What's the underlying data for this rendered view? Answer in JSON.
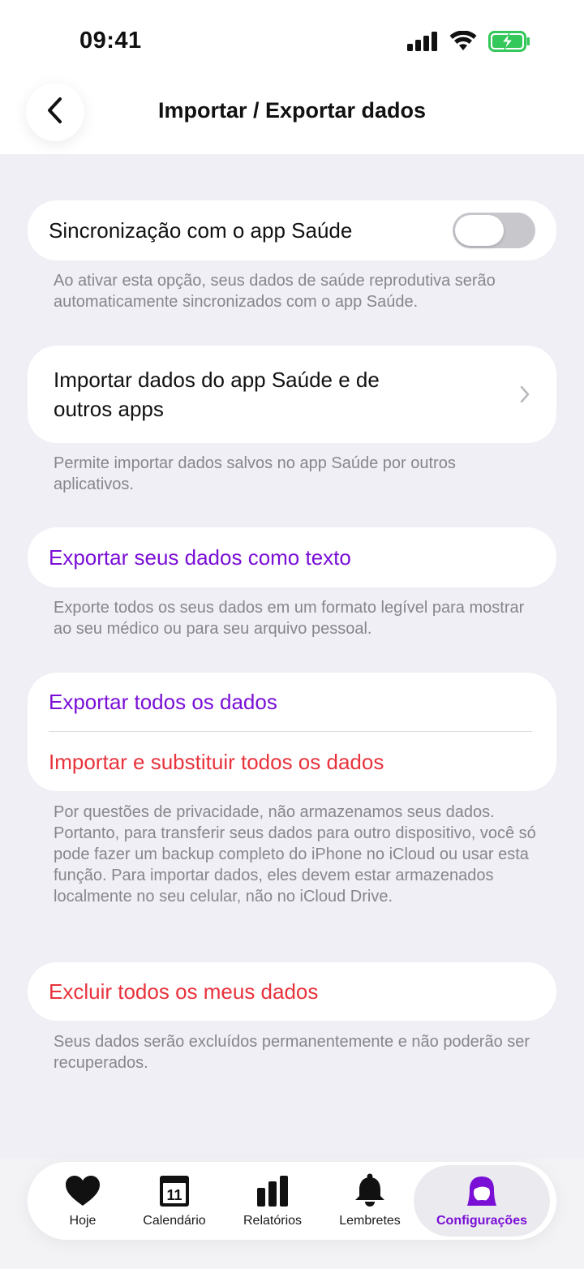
{
  "status_bar": {
    "time": "09:41",
    "icons": [
      "cellular-signal-icon",
      "wifi-icon",
      "battery-charging-icon"
    ]
  },
  "header": {
    "title": "Importar / Exportar dados",
    "back_icon": "chevron-left-icon"
  },
  "sections": {
    "health_sync": {
      "label": "Sincronização com o app Saúde",
      "toggle_on": false,
      "note": "Ao ativar esta opção, seus dados de saúde reprodutiva serão automaticamente sincronizados com o app Saúde."
    },
    "import_health": {
      "label_line1": "Importar dados do app Saúde e de",
      "label_line2": "outros apps",
      "note": "Permite importar dados salvos no app Saúde por outros aplicativos."
    },
    "export_text": {
      "label": "Exportar seus dados como texto",
      "note": "Exporte todos os seus dados em um formato legível para mostrar ao seu médico ou para seu arquivo pessoal."
    },
    "export_import_all": {
      "export_label": "Exportar todos os dados",
      "import_label": "Importar e substituir todos os dados",
      "note": "Por questões de privacidade, não armazenamos seus dados. Portanto, para transferir seus dados para outro dispositivo, você só pode fazer um backup completo do iPhone no iCloud ou usar esta função. Para importar dados, eles devem estar armazenados localmente no seu celular, não no iCloud Drive."
    },
    "delete_all": {
      "label": "Excluir todos os meus dados",
      "note": "Seus dados serão excluídos permanentemente e não poderão ser recuperados."
    }
  },
  "tabbar": {
    "tabs": [
      {
        "label": "Hoje",
        "icon": "heart-icon"
      },
      {
        "label": "Calendário",
        "icon": "calendar-icon",
        "icon_text": "11"
      },
      {
        "label": "Relatórios",
        "icon": "bar-chart-icon"
      },
      {
        "label": "Lembretes",
        "icon": "bell-icon"
      },
      {
        "label": "Configurações",
        "icon": "profile-icon",
        "active": true
      }
    ]
  },
  "colors": {
    "accent": "#7a0fd6",
    "destructive": "#e8323c",
    "background": "#f0eff5",
    "battery": "#34c759"
  }
}
